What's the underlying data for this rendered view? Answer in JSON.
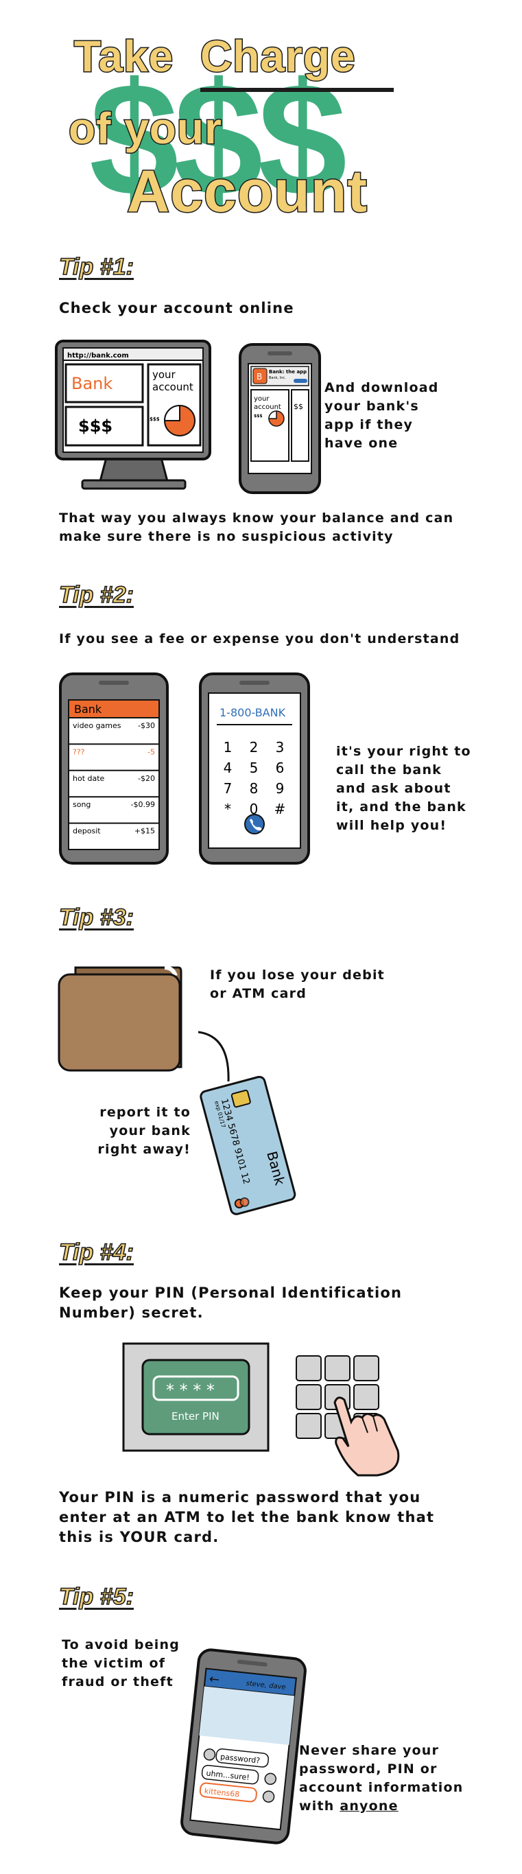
{
  "header": {
    "line1_a": "Take",
    "line1_b": "Charge",
    "line2": "of your",
    "line3": "Account",
    "dollar_signs": "$$$"
  },
  "tip1": {
    "heading": "Tip #1:",
    "intro": "Check your account online",
    "desktop": {
      "url": "http://bank.com",
      "brand": "Bank",
      "panel_label": "your account",
      "balance": "$$$",
      "chart_label": "$$$"
    },
    "phone": {
      "app_icon": "B",
      "app_title": "Bank: the app",
      "app_subtitle": "Bank, Inc.",
      "panel_label": "your account",
      "balance": "$$"
    },
    "side_note": [
      "And download",
      "your bank's",
      "app if they",
      "have one"
    ],
    "outro": [
      "That way you always know your balance and can",
      "make sure there is no suspicious activity"
    ]
  },
  "tip2": {
    "heading": "Tip #2:",
    "intro": "If you see a fee or expense you don't understand",
    "transactions_title": "Bank",
    "transactions": [
      {
        "name": "video games",
        "amount": "-$30"
      },
      {
        "name": "???",
        "amount": "-5"
      },
      {
        "name": "hot date",
        "amount": "-$20"
      },
      {
        "name": "song",
        "amount": "-$0.99"
      },
      {
        "name": "deposit",
        "amount": "+$15"
      }
    ],
    "dialer_number": "1-800-BANK",
    "keypad": [
      "1",
      "2",
      "3",
      "4",
      "5",
      "6",
      "7",
      "8",
      "9",
      "*",
      "0",
      "#"
    ],
    "side_note": [
      "it's your right to",
      "call the bank",
      "and ask about",
      "it, and the bank",
      "will help you!"
    ]
  },
  "tip3": {
    "heading": "Tip #3:",
    "lose_card": [
      "If you lose your debit",
      "or ATM card"
    ],
    "report": [
      "report it to",
      "your bank",
      "right away!"
    ],
    "card_number": "1234 5678 9101 12",
    "card_exp": "exp 01/17",
    "card_brand": "Bank"
  },
  "tip4": {
    "heading": "Tip #4:",
    "intro": [
      "Keep your PIN (Personal Identification",
      "Number) secret."
    ],
    "pin_mask": "* * * *",
    "pin_label": "Enter PIN",
    "outro": [
      "Your PIN is a numeric password that you",
      "enter at an ATM to let the bank know that",
      "this is YOUR card."
    ]
  },
  "tip5": {
    "heading": "Tip #5:",
    "intro": [
      "To avoid being",
      "the victim of",
      "fraud or theft"
    ],
    "chat_contact": "steve, dave",
    "chat": [
      "password?",
      "uhm...sure!",
      "kittens68"
    ],
    "warning": [
      "Never share your",
      "password, PIN or",
      "account information",
      "with"
    ],
    "warning_emphasis": "anyone"
  },
  "colors": {
    "yellow": "#f2cf74",
    "green": "#3fae7f",
    "orange": "#ec6a2e",
    "blue": "#2f6eb7",
    "gray_device": "#777777",
    "light_gray": "#d4d4d4",
    "wallet": "#a8805a",
    "card": "#a9cde0"
  }
}
